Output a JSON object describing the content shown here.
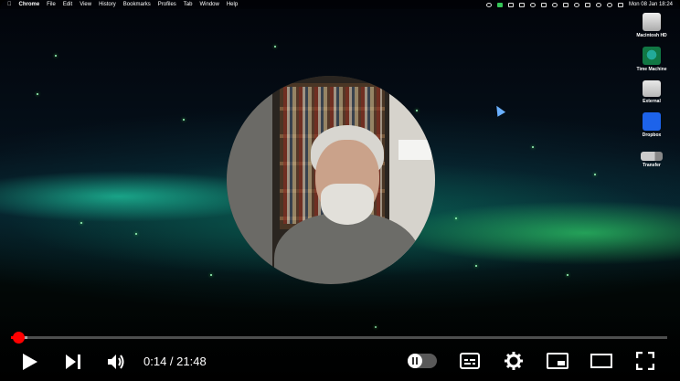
{
  "menubar": {
    "app": "Chrome",
    "items": [
      "File",
      "Edit",
      "View",
      "History",
      "Bookmarks",
      "Profiles",
      "Tab",
      "Window",
      "Help"
    ],
    "clock": "Mon 08 Jan  18:24"
  },
  "desktop": {
    "icons": [
      {
        "label": "Macintosh HD",
        "icon": "hard-drive-icon"
      },
      {
        "label": "Time Machine",
        "icon": "time-machine-icon"
      },
      {
        "label": "External",
        "icon": "external-drive-icon"
      },
      {
        "label": "Dropbox",
        "icon": "dropbox-icon"
      },
      {
        "label": "Transfer",
        "icon": "usb-drive-icon"
      }
    ]
  },
  "player": {
    "current_time": "0:14",
    "duration": "21:48",
    "time_display": "0:14 / 21:48",
    "progress_fraction": 0.0107,
    "buffered_fraction": 0.025,
    "accent_color": "#ff0000",
    "controls": [
      "play-icon",
      "next-icon",
      "volume-icon",
      "autoplay-toggle",
      "subtitles-icon",
      "settings-icon",
      "miniplayer-icon",
      "theater-icon",
      "fullscreen-icon"
    ]
  }
}
